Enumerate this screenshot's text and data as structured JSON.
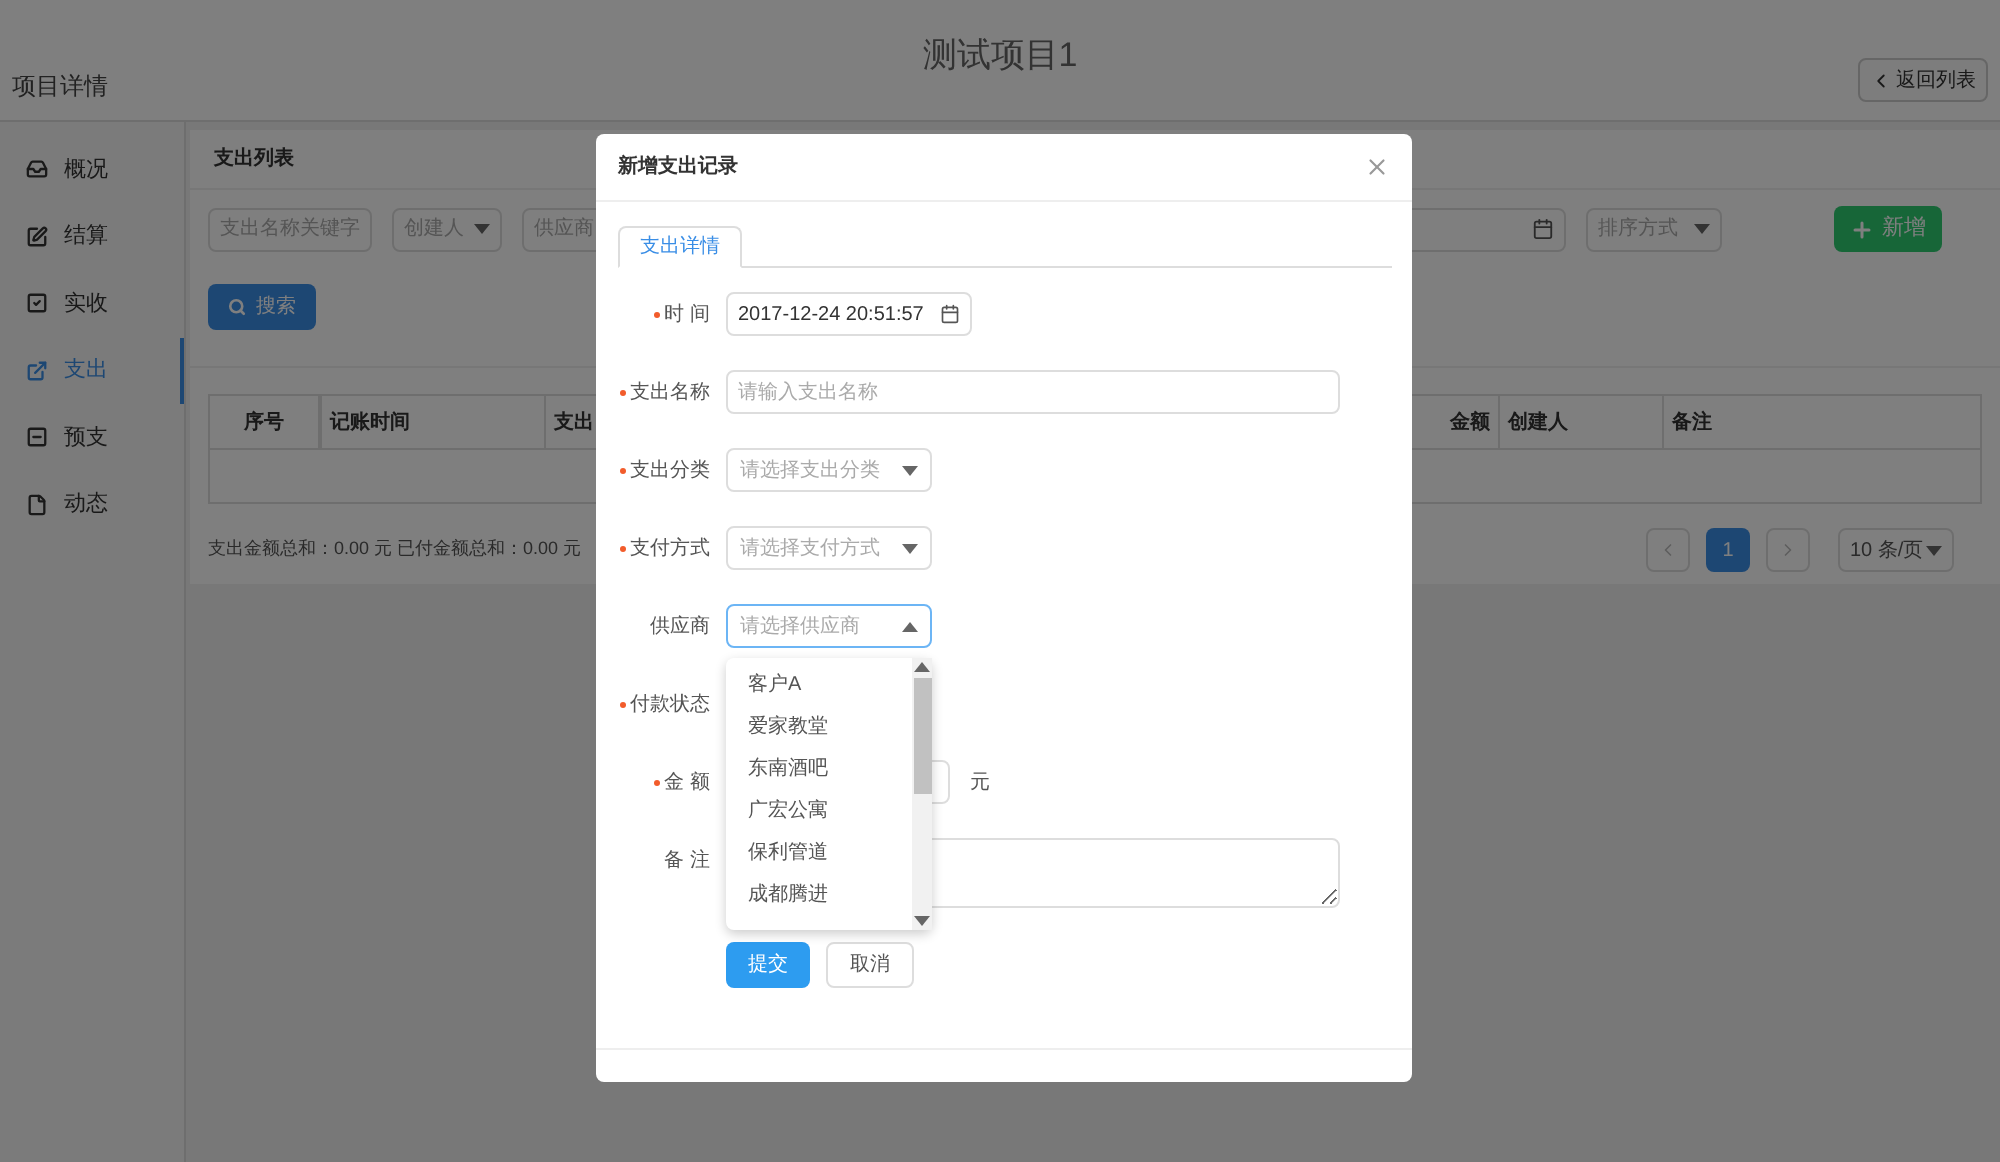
{
  "header": {
    "title": "测试项目1",
    "subtitle": "项目详情",
    "back_button": "返回列表"
  },
  "sidebar": {
    "items": [
      {
        "label": "概况",
        "selected": false
      },
      {
        "label": "结算",
        "selected": false
      },
      {
        "label": "实收",
        "selected": false
      },
      {
        "label": "支出",
        "selected": true
      },
      {
        "label": "预支",
        "selected": false
      },
      {
        "label": "动态",
        "selected": false
      }
    ]
  },
  "panel": {
    "title": "支出列表",
    "filters": [
      {
        "kind": "input",
        "placeholder": "支出名称关键字"
      },
      {
        "kind": "select",
        "placeholder": "创建人"
      },
      {
        "kind": "input",
        "placeholder": "供应商"
      },
      {
        "kind": "date"
      },
      {
        "kind": "select",
        "placeholder": "排序方式"
      }
    ],
    "add_button": "新增",
    "search_button": "搜索",
    "table": {
      "columns": [
        "序号",
        "记账时间",
        "支出",
        "金额",
        "创建人",
        "备注"
      ]
    },
    "totals": "支出金额总和：0.00 元 已付金额总和：0.00 元",
    "pagination": {
      "pages": [
        {
          "label": "1",
          "selected": true
        }
      ],
      "page_size": "10 条/页"
    }
  },
  "modal": {
    "title": "新增支出记录",
    "tabs": [
      {
        "label": "支出详情",
        "selected": true
      }
    ],
    "fields": [
      {
        "label": "时 间",
        "required": true,
        "kind": "datetime",
        "value": "2017-12-24 20:51:57"
      },
      {
        "label": "支出名称",
        "required": true,
        "kind": "text",
        "placeholder": "请输入支出名称"
      },
      {
        "label": "支出分类",
        "required": true,
        "kind": "select",
        "placeholder": "请选择支出分类",
        "expanded": false
      },
      {
        "label": "支付方式",
        "required": true,
        "kind": "select",
        "placeholder": "请选择支付方式",
        "expanded": false
      },
      {
        "label": "供应商",
        "required": false,
        "kind": "select",
        "placeholder": "请选择供应商",
        "expanded": true,
        "options": [
          "客户A",
          "爱家教堂",
          "东南酒吧",
          "广宏公寓",
          "保利管道",
          "成都腾进"
        ]
      },
      {
        "label": "付款状态",
        "required": true,
        "kind": "covered"
      },
      {
        "label": "金 额",
        "required": true,
        "kind": "amount",
        "unit": "元"
      },
      {
        "label": "备 注",
        "required": false,
        "kind": "textarea"
      }
    ],
    "buttons": [
      {
        "label": "提交",
        "kind": "primary"
      },
      {
        "label": "取消",
        "kind": "default"
      }
    ]
  }
}
